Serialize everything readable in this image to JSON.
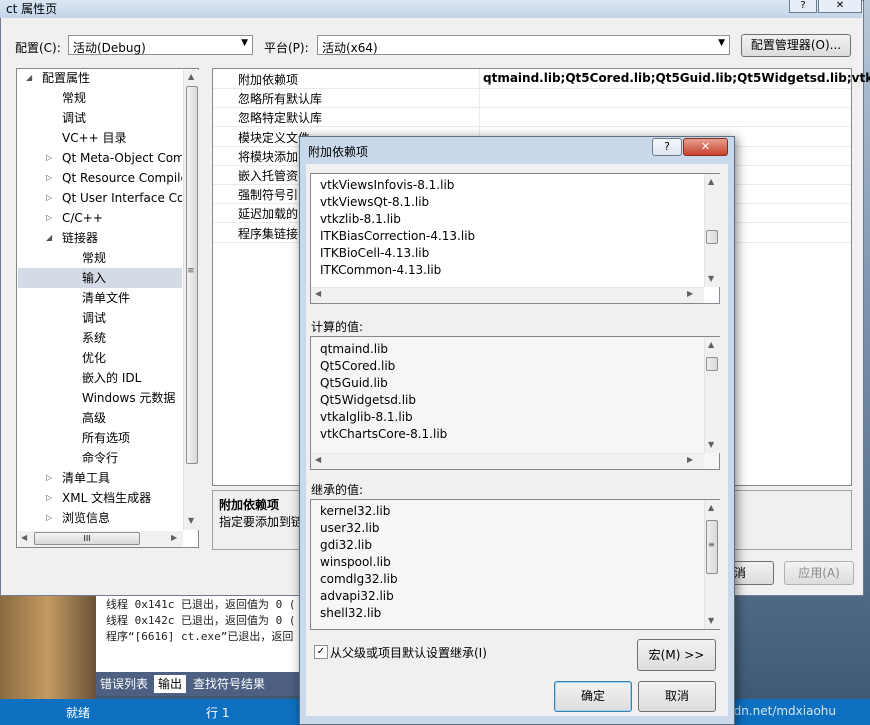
{
  "property_window": {
    "title": "ct 属性页",
    "help_glyph": "?",
    "close_glyph": "✕",
    "config_label": "配置(C):",
    "config_value": "活动(Debug)",
    "platform_label": "平台(P):",
    "platform_value": "活动(x64)",
    "config_manager_button": "配置管理器(O)...",
    "tree": [
      {
        "label": "配置属性",
        "expander": "◢",
        "indent": 0
      },
      {
        "label": "常规",
        "expander": "",
        "indent": 1
      },
      {
        "label": "调试",
        "expander": "",
        "indent": 1
      },
      {
        "label": "VC++ 目录",
        "expander": "",
        "indent": 1
      },
      {
        "label": "Qt Meta-Object Com",
        "expander": "▷",
        "indent": 1
      },
      {
        "label": "Qt Resource Compile",
        "expander": "▷",
        "indent": 1
      },
      {
        "label": "Qt User Interface Co",
        "expander": "▷",
        "indent": 1
      },
      {
        "label": "C/C++",
        "expander": "▷",
        "indent": 1
      },
      {
        "label": "链接器",
        "expander": "◢",
        "indent": 1
      },
      {
        "label": "常规",
        "expander": "",
        "indent": 2
      },
      {
        "label": "输入",
        "expander": "",
        "indent": 2,
        "selected": true
      },
      {
        "label": "清单文件",
        "expander": "",
        "indent": 2
      },
      {
        "label": "调试",
        "expander": "",
        "indent": 2
      },
      {
        "label": "系统",
        "expander": "",
        "indent": 2
      },
      {
        "label": "优化",
        "expander": "",
        "indent": 2
      },
      {
        "label": "嵌入的 IDL",
        "expander": "",
        "indent": 2
      },
      {
        "label": "Windows 元数据",
        "expander": "",
        "indent": 2
      },
      {
        "label": "高级",
        "expander": "",
        "indent": 2
      },
      {
        "label": "所有选项",
        "expander": "",
        "indent": 2
      },
      {
        "label": "命令行",
        "expander": "",
        "indent": 2
      },
      {
        "label": "清单工具",
        "expander": "▷",
        "indent": 1
      },
      {
        "label": "XML 文档生成器",
        "expander": "▷",
        "indent": 1
      },
      {
        "label": "浏览信息",
        "expander": "▷",
        "indent": 1
      }
    ],
    "tree_hscroll_thumb": "III",
    "properties": [
      {
        "name": "附加依赖项",
        "value": "qtmaind.lib;Qt5Cored.lib;Qt5Guid.lib;Qt5Widgetsd.lib;vtkalg"
      },
      {
        "name": "忽略所有默认库",
        "value": ""
      },
      {
        "name": "忽略特定默认库",
        "value": ""
      },
      {
        "name": "模块定义文件",
        "value": ""
      },
      {
        "name": "将模块添加",
        "value": ""
      },
      {
        "name": "嵌入托管资",
        "value": ""
      },
      {
        "name": "强制符号引",
        "value": ""
      },
      {
        "name": "延迟加载的",
        "value": ""
      },
      {
        "name": "程序集链接",
        "value": ""
      }
    ],
    "desc_title": "附加依赖项",
    "desc_text": "指定要添加到链",
    "cancel_button": "取消",
    "apply_button": "应用(A)"
  },
  "dialog": {
    "title": "附加依赖项",
    "help_glyph": "?",
    "close_glyph": "✕",
    "edit_items": [
      "vtkViewsInfovis-8.1.lib",
      "vtkViewsQt-8.1.lib",
      "vtkzlib-8.1.lib",
      "ITKBiasCorrection-4.13.lib",
      "ITKBioCell-4.13.lib",
      "ITKCommon-4.13.lib"
    ],
    "computed_label": "计算的值:",
    "computed_items": [
      "qtmaind.lib",
      "Qt5Cored.lib",
      "Qt5Guid.lib",
      "Qt5Widgetsd.lib",
      "vtkalglib-8.1.lib",
      "vtkChartsCore-8.1.lib"
    ],
    "inherited_label": "继承的值:",
    "inherited_items": [
      "kernel32.lib",
      "user32.lib",
      "gdi32.lib",
      "winspool.lib",
      "comdlg32.lib",
      "advapi32.lib",
      "shell32.lib"
    ],
    "inherit_checkbox_label": "从父级或项目默认设置继承(I)",
    "inherit_checked": "✓",
    "macro_button": "宏(M) >>",
    "ok_button": "确定",
    "cancel_button": "取消"
  },
  "vs": {
    "output_lines": [
      "线程 0x141c 已退出，返回值为 0 (",
      "线程 0x142c 已退出，返回值为 0 (",
      "程序“[6616] ct.exe”已退出，返回"
    ],
    "tabs": [
      "错误列表",
      "输出",
      "查找符号结果"
    ],
    "status_ready": "就绪",
    "status_line": "行 1",
    "watermark": "https://blog.csdn.net/mdxiaohu"
  }
}
